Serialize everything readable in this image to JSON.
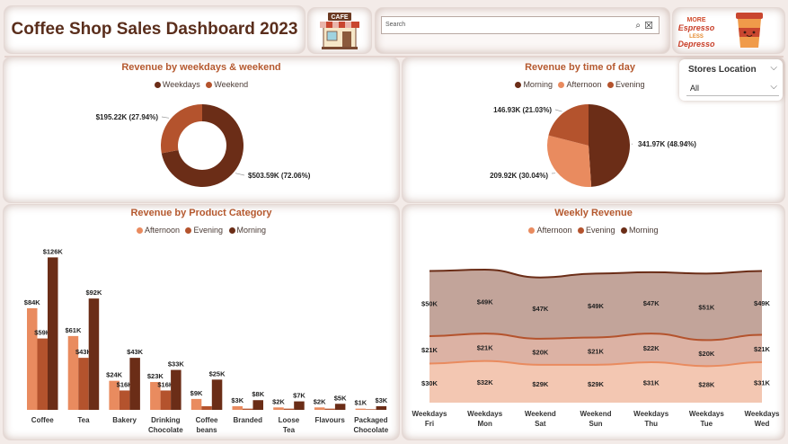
{
  "header": {
    "title": "Coffee Shop Sales Dashboard 2023",
    "cafe_sign": "CAFE",
    "search_placeholder": "Search",
    "espresso_text": [
      "MORE",
      "Espresso",
      "LESS",
      "Depresso"
    ]
  },
  "slicer": {
    "title": "Stores Location",
    "value": "All"
  },
  "colors": {
    "morning": "#6b2d17",
    "afternoon": "#e98b5f",
    "evening": "#b4532d",
    "weekdays": "#6b2d17",
    "weekend": "#b4532d"
  },
  "chart_data": [
    {
      "type": "pie",
      "donut": true,
      "title": "Revenue by weekdays & weekend",
      "legend": [
        "Weekdays",
        "Weekend"
      ],
      "legend_position": "top",
      "slices": [
        {
          "name": "Weekdays",
          "value": 503.59,
          "label": "$503.59K (72.06%)",
          "color": "#6b2d17"
        },
        {
          "name": "Weekend",
          "value": 195.22,
          "label": "$195.22K (27.94%)",
          "color": "#b4532d"
        }
      ]
    },
    {
      "type": "pie",
      "donut": false,
      "title": "Revenue by time of day",
      "legend": [
        "Morning",
        "Afternoon",
        "Evening"
      ],
      "legend_position": "top",
      "slices": [
        {
          "name": "Morning",
          "value": 341.97,
          "label": "341.97K (48.94%)",
          "color": "#6b2d17"
        },
        {
          "name": "Afternoon",
          "value": 209.92,
          "label": "209.92K (30.04%)",
          "color": "#e98b5f"
        },
        {
          "name": "Evening",
          "value": 146.93,
          "label": "146.93K (21.03%)",
          "color": "#b4532d"
        }
      ]
    },
    {
      "type": "bar",
      "title": "Revenue by Product Category",
      "legend": [
        "Afternoon",
        "Evening",
        "Morning"
      ],
      "legend_position": "top",
      "categories": [
        "Coffee",
        "Tea",
        "Bakery",
        "Drinking Chocolate",
        "Coffee beans",
        "Branded",
        "Loose Tea",
        "Flavours",
        "Packaged Chocolate"
      ],
      "series": [
        {
          "name": "Afternoon",
          "color": "#e98b5f",
          "values": [
            84,
            61,
            24,
            23,
            9,
            3,
            2,
            2,
            1
          ],
          "labels": [
            "$84K",
            "$61K",
            "$24K",
            "$23K",
            "$9K",
            "$3K",
            "$2K",
            "$2K",
            "$1K"
          ]
        },
        {
          "name": "Evening",
          "color": "#b4532d",
          "values": [
            59,
            43,
            16,
            16,
            3,
            1,
            1,
            1,
            0.5
          ],
          "labels": [
            "$59K",
            "$43K",
            "$16K",
            "$16K",
            "",
            "",
            "",
            "",
            ""
          ]
        },
        {
          "name": "Morning",
          "color": "#6b2d17",
          "values": [
            126,
            92,
            43,
            33,
            25,
            8,
            7,
            5,
            3
          ],
          "labels": [
            "$126K",
            "$92K",
            "$43K",
            "$33K",
            "$25K",
            "$8K",
            "$7K",
            "$5K",
            "$3K"
          ]
        }
      ],
      "ylim": [
        0,
        130
      ]
    },
    {
      "type": "area",
      "stacked": true,
      "title": "Weekly Revenue",
      "legend": [
        "Afternoon",
        "Evening",
        "Morning"
      ],
      "legend_position": "top",
      "categories": [
        "Weekdays Fri",
        "Weekdays Mon",
        "Weekend Sat",
        "Weekend Sun",
        "Weekdays Thu",
        "Weekdays Tue",
        "Weekdays Wed"
      ],
      "series": [
        {
          "name": "Afternoon",
          "color": "#f3c7b2",
          "line": "#e98b5f",
          "values": [
            30,
            32,
            29,
            29,
            31,
            28,
            31
          ],
          "labels": [
            "$30K",
            "$32K",
            "$29K",
            "$29K",
            "$31K",
            "$28K",
            "$31K"
          ]
        },
        {
          "name": "Evening",
          "color": "#dcb2a4",
          "line": "#b4532d",
          "values": [
            21,
            21,
            20,
            21,
            22,
            20,
            21
          ],
          "labels": [
            "$21K",
            "$21K",
            "$20K",
            "$21K",
            "$22K",
            "$20K",
            "$21K"
          ]
        },
        {
          "name": "Morning",
          "color": "#c2a49a",
          "line": "#6b2d17",
          "values": [
            50,
            49,
            47,
            49,
            47,
            51,
            49
          ],
          "labels": [
            "$50K",
            "$49K",
            "$47K",
            "$49K",
            "$47K",
            "$51K",
            "$49K"
          ]
        }
      ]
    }
  ]
}
